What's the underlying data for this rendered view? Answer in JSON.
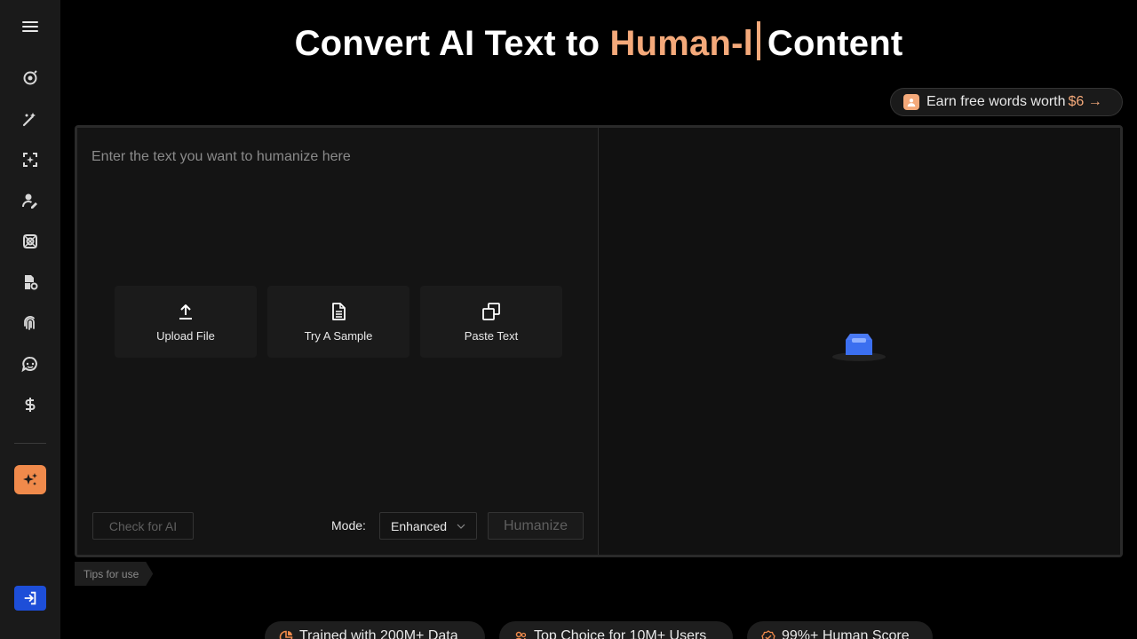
{
  "header": {
    "title_prefix": "Convert AI Text to ",
    "title_highlight": "Human-l",
    "title_suffix": "Content"
  },
  "earn": {
    "text": "Earn free words worth",
    "amount": "$6 →"
  },
  "editor": {
    "placeholder": "Enter the text you want to humanize here",
    "actions": [
      {
        "label": "Upload File",
        "icon": "upload-icon"
      },
      {
        "label": "Try A Sample",
        "icon": "document-icon"
      },
      {
        "label": "Paste Text",
        "icon": "copy-icon"
      }
    ],
    "check_label": "Check for AI",
    "mode_label": "Mode:",
    "mode_value": "Enhanced",
    "humanize_label": "Humanize"
  },
  "tips_label": "Tips for use",
  "badges": [
    {
      "text": "Trained with 200M+ Data",
      "icon": "pie-chart-icon"
    },
    {
      "text": "Top Choice for 10M+ Users",
      "icon": "users-icon"
    },
    {
      "text": "99%+ Human Score",
      "icon": "badge-check-icon"
    }
  ],
  "sidebar": {
    "items": [
      "menu-icon",
      "detector-icon",
      "humanizer-icon",
      "scan-icon",
      "user-edit-icon",
      "target-icon",
      "doc-tool-icon",
      "fingerprint-icon",
      "chat-icon",
      "dollar-icon"
    ]
  },
  "colors": {
    "accent_orange": "#f4a97a",
    "spark_button": "#f08a4b",
    "login_button": "#1d4ed8",
    "empty_state_blue": "#3b6ff0"
  }
}
